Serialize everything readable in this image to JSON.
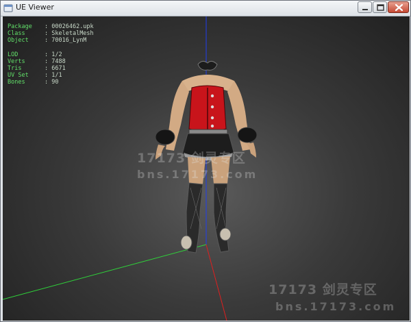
{
  "window": {
    "title": "UE Viewer",
    "icon": "ue-viewer-app-icon"
  },
  "controls": {
    "minimize_icon": "minimize-icon",
    "maximize_icon": "maximize-icon",
    "close_icon": "close-icon"
  },
  "info": {
    "package_key": "Package",
    "package_value": "00026462.upk",
    "class_key": "Class",
    "class_value": "SkeletalMesh",
    "object_key": "Object",
    "object_value": "70016_LynM",
    "lod_key": "LOD",
    "lod_value": "1/2",
    "verts_key": "Verts",
    "verts_value": "7488",
    "tris_key": "Tris",
    "tris_value": "6671",
    "uvset_key": "UV Set",
    "uvset_value": "1/1",
    "bones_key": "Bones",
    "bones_value": "90"
  },
  "watermark": {
    "line1": "17173 剑灵专区",
    "line2": "bns.17173.com"
  },
  "colors": {
    "axis_x": "#2fd33a",
    "axis_y": "#1f3df0",
    "axis_z": "#e01f1f",
    "info_key": "#62e16a",
    "corset": "#c8141b"
  }
}
